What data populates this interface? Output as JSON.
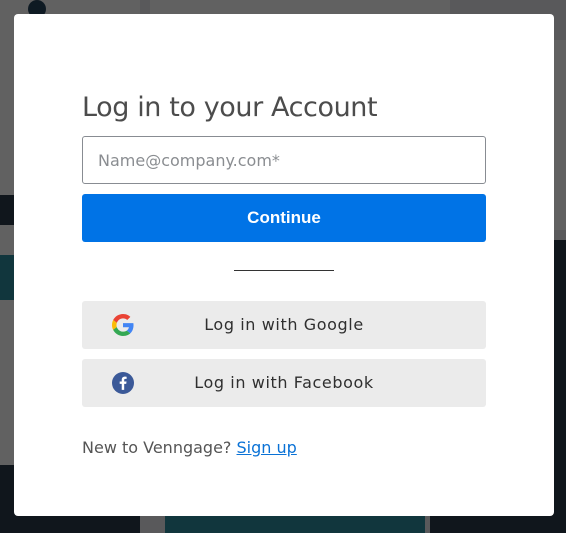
{
  "modal": {
    "title": "Log in to your Account",
    "email_placeholder": "Name@company.com*",
    "continue_label": "Continue",
    "google_label": "Log in with Google",
    "facebook_label": "Log in with Facebook",
    "signup_prompt": "New to Venngage?",
    "signup_link": "Sign up"
  },
  "icons": {
    "google": "google-icon",
    "facebook": "facebook-icon"
  },
  "colors": {
    "primary": "#0073e6",
    "social_bg": "#ebebeb",
    "link": "#0a72d6",
    "facebook": "#3b5998"
  }
}
